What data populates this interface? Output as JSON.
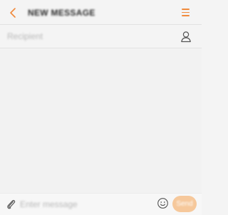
{
  "header": {
    "title": "NEW MESSAGE",
    "back_icon": "chevron-left-icon",
    "menu_icon": "hamburger-menu-icon"
  },
  "recipient": {
    "placeholder": "Recipient",
    "value": "",
    "contact_icon": "person-icon"
  },
  "composer": {
    "attach_icon": "paperclip-icon",
    "placeholder": "Enter message",
    "value": "",
    "emoji_icon": "smiley-icon",
    "send_label": "Send"
  },
  "colors": {
    "accent": "#f08a3c",
    "send_button": "#f6c89b",
    "background": "#f4f4f4",
    "divider": "#e2e2e2",
    "icon_gray": "#555555"
  }
}
